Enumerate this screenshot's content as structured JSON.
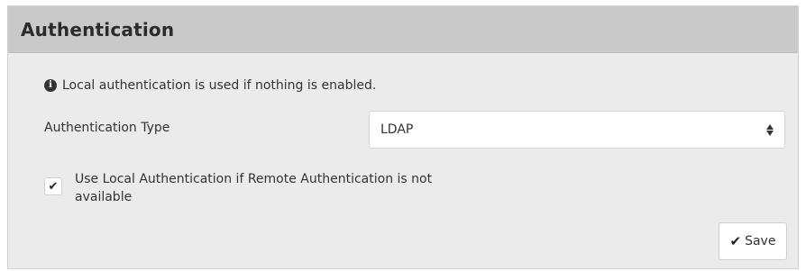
{
  "panel": {
    "title": "Authentication"
  },
  "info": {
    "icon": "info-circle-icon",
    "text": "Local authentication is used if nothing is enabled."
  },
  "auth_type": {
    "label": "Authentication Type",
    "selected": "LDAP"
  },
  "local_fallback": {
    "checked": true,
    "label": "Use Local Authentication if Remote Authentication is not available"
  },
  "save_button": {
    "icon": "checkmark-icon",
    "label": "Save"
  }
}
